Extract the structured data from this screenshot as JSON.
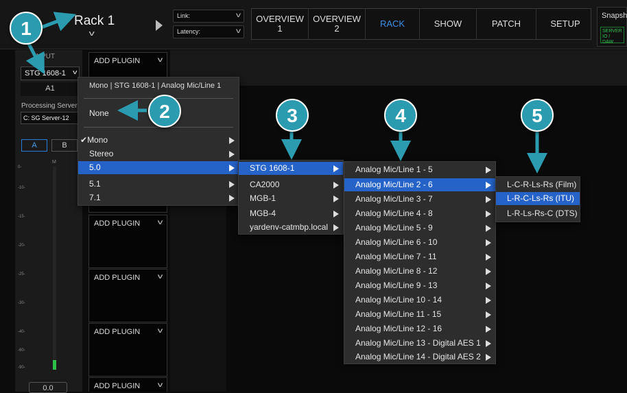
{
  "header": {
    "rack_title": "Rack 1",
    "link_label": "Link:",
    "latency_label": "Latency:",
    "tabs": [
      {
        "line1": "OVERVIEW",
        "line2": "1"
      },
      {
        "line1": "OVERVIEW",
        "line2": "2"
      },
      {
        "line1": "RACK",
        "line2": ""
      },
      {
        "line1": "SHOW",
        "line2": ""
      },
      {
        "line1": "PATCH",
        "line2": ""
      },
      {
        "line1": "SETUP",
        "line2": ""
      }
    ],
    "active_tab": "RACK",
    "snapshot_label": "Snapsh",
    "server_badge_line1": "SERVER",
    "server_badge_line2": "IO / DAW"
  },
  "input_panel": {
    "label": "INPUT",
    "device": "STG 1608-1",
    "channel": "A1",
    "processing_label": "Processing Server",
    "processing_value": "C: SG Server-12",
    "btn_a": "A",
    "btn_b": "B",
    "fader_label": "M",
    "scale": [
      "0-",
      "-10-",
      "-15-",
      "-20-",
      "-25-",
      "-30-",
      "-40-",
      "-60-",
      "-90-"
    ],
    "meter_level_percent": 5,
    "volume": "0.0"
  },
  "plugins": {
    "add_label": "ADD PLUGIN"
  },
  "menu1": {
    "title": "Mono | STG 1608-1 | Analog Mic/Line 1",
    "none": "None",
    "items": [
      {
        "label": "Mono",
        "checked": true
      },
      {
        "label": "Stereo"
      },
      {
        "label": "5.0",
        "highlighted": true
      },
      {
        "label": "5.1"
      },
      {
        "label": "7.1"
      }
    ],
    "check_glyph": "✔"
  },
  "menu2": {
    "items": [
      "STG 1608-1",
      "CA2000",
      "MGB-1",
      "MGB-4",
      "yardenv-catmbp.local"
    ]
  },
  "menu3": {
    "items": [
      "Analog Mic/Line 1 - 5",
      "Analog Mic/Line 2 - 6",
      "Analog Mic/Line 3 - 7",
      "Analog Mic/Line 4 - 8",
      "Analog Mic/Line 5 - 9",
      "Analog Mic/Line 6 - 10",
      "Analog Mic/Line 7 - 11",
      "Analog Mic/Line 8 - 12",
      "Analog Mic/Line 9 - 13",
      "Analog Mic/Line 10 - 14",
      "Analog Mic/Line 11 - 15",
      "Analog Mic/Line 12 - 16",
      "Analog Mic/Line 13 - Digital AES 1",
      "Analog Mic/Line 14 - Digital AES 2"
    ]
  },
  "menu4": {
    "items": [
      "L-C-R-Ls-Rs (Film)",
      "L-R-C-Ls-Rs (ITU)",
      "L-R-Ls-Rs-C (DTS)"
    ]
  },
  "callouts": [
    "1",
    "2",
    "3",
    "4",
    "5"
  ],
  "colors": {
    "highlight": "#2563c9",
    "callout": "#2b9bb0",
    "active_tab": "#3a8fe8",
    "meter": "#2ec14a"
  }
}
